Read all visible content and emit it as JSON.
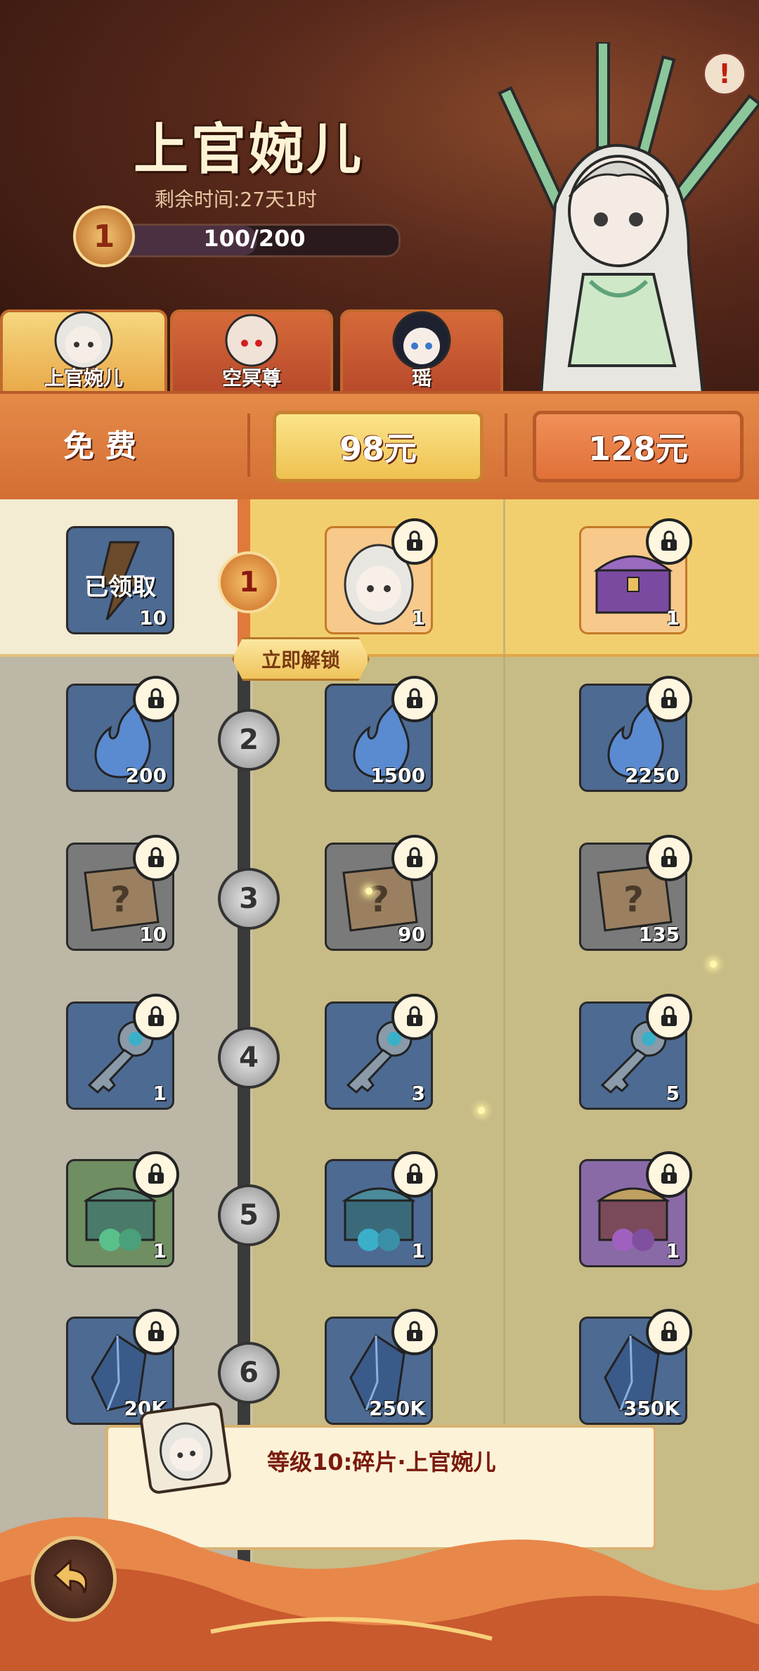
{
  "header": {
    "hero_name": "上官婉儿",
    "remaining_time": "剩余时间:27天1时",
    "level": "1",
    "xp_text": "100/200",
    "xp_fraction": 0.5,
    "alert_symbol": "!"
  },
  "tabs": [
    {
      "label": "上官婉儿",
      "active": true
    },
    {
      "label": "空冥尊",
      "active": false
    },
    {
      "label": "瑶",
      "active": false
    }
  ],
  "tiers": {
    "free": "免费",
    "tier2": "98元",
    "tier3": "128元"
  },
  "unlock_button": "立即解锁",
  "rows": [
    {
      "level": "1",
      "free": {
        "count": "10",
        "claimed": "已领取",
        "icon": "lightning-shard-icon"
      },
      "t2": {
        "count": "1",
        "icon": "hero-avatar-icon"
      },
      "t3": {
        "count": "1",
        "icon": "treasure-chest-icon"
      }
    },
    {
      "level": "2",
      "free": {
        "count": "200",
        "icon": "spirit-flame-icon"
      },
      "t2": {
        "count": "1500",
        "icon": "spirit-flame-icon"
      },
      "t3": {
        "count": "2250",
        "icon": "spirit-flame-icon"
      }
    },
    {
      "level": "3",
      "free": {
        "count": "10",
        "icon": "mystery-scroll-icon"
      },
      "t2": {
        "count": "90",
        "icon": "mystery-scroll-icon"
      },
      "t3": {
        "count": "135",
        "icon": "mystery-scroll-icon"
      }
    },
    {
      "level": "4",
      "free": {
        "count": "1",
        "icon": "key-icon"
      },
      "t2": {
        "count": "3",
        "icon": "key-icon"
      },
      "t3": {
        "count": "5",
        "icon": "key-icon"
      }
    },
    {
      "level": "5",
      "free": {
        "count": "1",
        "icon": "green-chest-icon"
      },
      "t2": {
        "count": "1",
        "icon": "blue-chest-icon"
      },
      "t3": {
        "count": "1",
        "icon": "purple-chest-icon"
      }
    },
    {
      "level": "6",
      "free": {
        "count": "20K",
        "icon": "crystal-icon"
      },
      "t2": {
        "count": "250K",
        "icon": "crystal-icon"
      },
      "t3": {
        "count": "350K",
        "icon": "crystal-icon"
      }
    }
  ],
  "tooltip": {
    "text": "等级10:碎片·上官婉儿"
  },
  "colors": {
    "accent_gold": "#f2cf6e",
    "tier_orange": "#e07038",
    "tile_blue": "#4d6a92"
  }
}
